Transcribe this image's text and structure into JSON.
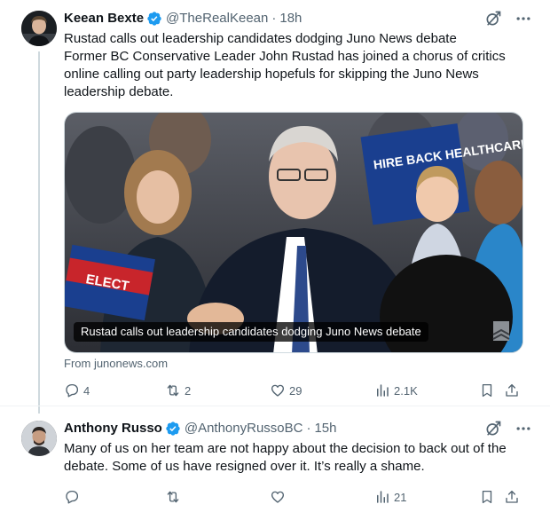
{
  "tweets": [
    {
      "author": {
        "name": "Keean Bexte",
        "handle": "@TheRealKeean",
        "time": "18h",
        "verified": true,
        "avatar_icon": "avatar-icon"
      },
      "text_lines": [
        "Rustad calls out leadership candidates dodging Juno News debate",
        "Former BC Conservative Leader John Rustad has joined a chorus of critics",
        "online calling out party leadership hopefuls for skipping the Juno News",
        "leadership debate."
      ],
      "media": {
        "caption": "Rustad calls out leadership candidates dodging Juno News debate",
        "sign_text": "HIRE BACK HEALTHCARE HER",
        "sign2_text": "ELECT"
      },
      "link_source": "From junonews.com",
      "actions": {
        "reply_count": "4",
        "retweet_count": "2",
        "like_count": "29",
        "views_count": "2.1K"
      }
    },
    {
      "author": {
        "name": "Anthony Russo",
        "handle": "@AnthonyRussoBC",
        "time": "15h",
        "verified": true,
        "avatar_icon": "avatar-icon"
      },
      "text_lines": [
        "Many of us on her team are not happy about the decision to back out of the",
        "debate. Some of us have resigned over it. It’s really a shame."
      ],
      "actions": {
        "reply_count": "",
        "retweet_count": "",
        "like_count": "",
        "views_count": "21"
      }
    }
  ],
  "colors": {
    "verified_blue": "#1d9bf0",
    "secondary_text": "#536471",
    "primary_text": "#0f1419",
    "border": "#cfd9de"
  },
  "separator": "·"
}
